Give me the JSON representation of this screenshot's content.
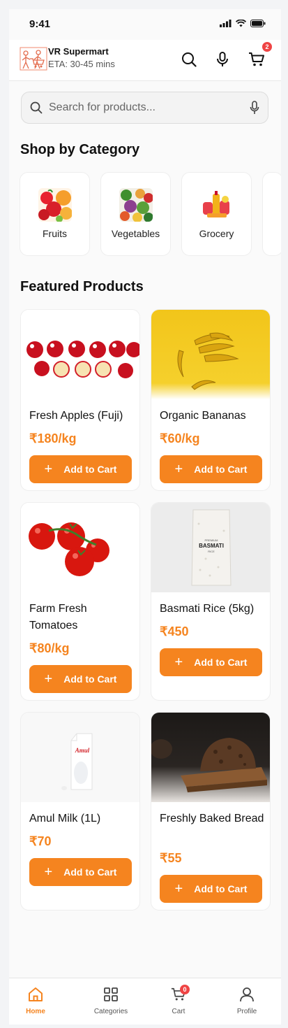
{
  "status": {
    "time": "9:41"
  },
  "header": {
    "brand": "VR Supermart",
    "eta": "ETA: 30-45 mins",
    "cart_count": "2"
  },
  "search": {
    "placeholder": "Search for products..."
  },
  "categories_title": "Shop by Category",
  "categories": [
    {
      "label": "Fruits",
      "icon": "fruits-image"
    },
    {
      "label": "Vegetables",
      "icon": "vegetables-image"
    },
    {
      "label": "Grocery",
      "icon": "grocery-image"
    }
  ],
  "featured_title": "Featured Products",
  "add_to_cart": "Add to Cart",
  "products": [
    {
      "name": "Fresh Apples (Fuji)",
      "price": "₹180/kg"
    },
    {
      "name": "Organic Bananas",
      "price": "₹60/kg"
    },
    {
      "name": "Farm Fresh Tomatoes",
      "price": "₹80/kg"
    },
    {
      "name": "Basmati Rice (5kg)",
      "price": "₹450"
    },
    {
      "name": "Amul Milk (1L)",
      "price": "₹70"
    },
    {
      "name": "Freshly Baked Bread",
      "price": "₹55"
    }
  ],
  "rice_pack": {
    "line1": "PREMIUM",
    "line2": "BASMATI",
    "line3": "RICE"
  },
  "milk_brand": "Amul",
  "nav": [
    {
      "label": "Home",
      "icon": "home-icon"
    },
    {
      "label": "Categories",
      "icon": "grid-icon"
    },
    {
      "label": "Cart",
      "icon": "cart-icon"
    },
    {
      "label": "Profile",
      "icon": "user-icon"
    }
  ],
  "nav_cart_count": "0",
  "colors": {
    "accent": "#f5841f",
    "badge": "#ef4444"
  }
}
